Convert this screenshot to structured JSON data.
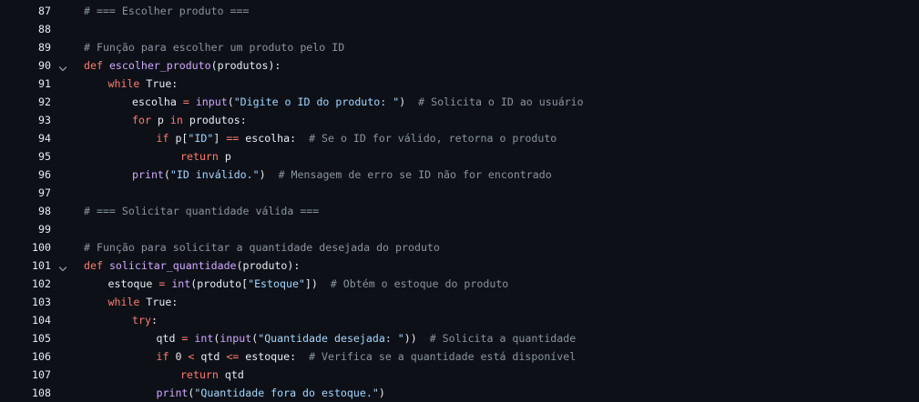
{
  "colors": {
    "background": "#0d1117",
    "text": "#e6edf3",
    "keyword": "#ff7b72",
    "function": "#d2a8ff",
    "string": "#a5d6ff",
    "comment": "#8b949e",
    "gutter": "#e6edf3"
  },
  "fold_icon": "chevron-down-icon",
  "lines": [
    {
      "n": "87",
      "indent": 0,
      "fold": false,
      "tokens": [
        {
          "t": "# === Escolher produto ===",
          "c": "cm"
        }
      ]
    },
    {
      "n": "88",
      "indent": 0,
      "fold": false,
      "tokens": []
    },
    {
      "n": "89",
      "indent": 0,
      "fold": false,
      "tokens": [
        {
          "t": "# Função para escolher um produto pelo ID",
          "c": "cm"
        }
      ]
    },
    {
      "n": "90",
      "indent": 0,
      "fold": true,
      "tokens": [
        {
          "t": "def",
          "c": "kw"
        },
        {
          "t": " ",
          "c": "tok"
        },
        {
          "t": "escolher_produto",
          "c": "fn"
        },
        {
          "t": "(produtos):",
          "c": "tok"
        }
      ]
    },
    {
      "n": "91",
      "indent": 1,
      "fold": false,
      "tokens": [
        {
          "t": "while",
          "c": "kw"
        },
        {
          "t": " True:",
          "c": "tok"
        }
      ]
    },
    {
      "n": "92",
      "indent": 2,
      "fold": false,
      "tokens": [
        {
          "t": "escolha ",
          "c": "tok"
        },
        {
          "t": "=",
          "c": "kw"
        },
        {
          "t": " ",
          "c": "tok"
        },
        {
          "t": "input",
          "c": "fn"
        },
        {
          "t": "(",
          "c": "tok"
        },
        {
          "t": "\"Digite o ID do produto: \"",
          "c": "str"
        },
        {
          "t": ")  ",
          "c": "tok"
        },
        {
          "t": "# Solicita o ID ao usuário",
          "c": "cm"
        }
      ]
    },
    {
      "n": "93",
      "indent": 2,
      "fold": false,
      "tokens": [
        {
          "t": "for",
          "c": "kw"
        },
        {
          "t": " p ",
          "c": "tok"
        },
        {
          "t": "in",
          "c": "kw"
        },
        {
          "t": " produtos:",
          "c": "tok"
        }
      ]
    },
    {
      "n": "94",
      "indent": 3,
      "fold": false,
      "tokens": [
        {
          "t": "if",
          "c": "kw"
        },
        {
          "t": " p[",
          "c": "tok"
        },
        {
          "t": "\"ID\"",
          "c": "str"
        },
        {
          "t": "] ",
          "c": "tok"
        },
        {
          "t": "==",
          "c": "kw"
        },
        {
          "t": " escolha:  ",
          "c": "tok"
        },
        {
          "t": "# Se o ID for válido, retorna o produto",
          "c": "cm"
        }
      ]
    },
    {
      "n": "95",
      "indent": 4,
      "fold": false,
      "tokens": [
        {
          "t": "return",
          "c": "kw"
        },
        {
          "t": " p",
          "c": "tok"
        }
      ]
    },
    {
      "n": "96",
      "indent": 2,
      "fold": false,
      "tokens": [
        {
          "t": "print",
          "c": "fn"
        },
        {
          "t": "(",
          "c": "tok"
        },
        {
          "t": "\"ID inválido.\"",
          "c": "str"
        },
        {
          "t": ")  ",
          "c": "tok"
        },
        {
          "t": "# Mensagem de erro se ID não for encontrado",
          "c": "cm"
        }
      ]
    },
    {
      "n": "97",
      "indent": 0,
      "fold": false,
      "tokens": []
    },
    {
      "n": "98",
      "indent": 0,
      "fold": false,
      "tokens": [
        {
          "t": "# === Solicitar quantidade válida ===",
          "c": "cm"
        }
      ]
    },
    {
      "n": "99",
      "indent": 0,
      "fold": false,
      "tokens": []
    },
    {
      "n": "100",
      "indent": 0,
      "fold": false,
      "tokens": [
        {
          "t": "# Função para solicitar a quantidade desejada do produto",
          "c": "cm"
        }
      ]
    },
    {
      "n": "101",
      "indent": 0,
      "fold": true,
      "tokens": [
        {
          "t": "def",
          "c": "kw"
        },
        {
          "t": " ",
          "c": "tok"
        },
        {
          "t": "solicitar_quantidade",
          "c": "fn"
        },
        {
          "t": "(produto):",
          "c": "tok"
        }
      ]
    },
    {
      "n": "102",
      "indent": 1,
      "fold": false,
      "tokens": [
        {
          "t": "estoque ",
          "c": "tok"
        },
        {
          "t": "=",
          "c": "kw"
        },
        {
          "t": " ",
          "c": "tok"
        },
        {
          "t": "int",
          "c": "fn"
        },
        {
          "t": "(produto[",
          "c": "tok"
        },
        {
          "t": "\"Estoque\"",
          "c": "str"
        },
        {
          "t": "])  ",
          "c": "tok"
        },
        {
          "t": "# Obtém o estoque do produto",
          "c": "cm"
        }
      ]
    },
    {
      "n": "103",
      "indent": 1,
      "fold": false,
      "tokens": [
        {
          "t": "while",
          "c": "kw"
        },
        {
          "t": " True:",
          "c": "tok"
        }
      ]
    },
    {
      "n": "104",
      "indent": 2,
      "fold": false,
      "tokens": [
        {
          "t": "try",
          "c": "kw"
        },
        {
          "t": ":",
          "c": "tok"
        }
      ]
    },
    {
      "n": "105",
      "indent": 3,
      "fold": false,
      "tokens": [
        {
          "t": "qtd ",
          "c": "tok"
        },
        {
          "t": "=",
          "c": "kw"
        },
        {
          "t": " ",
          "c": "tok"
        },
        {
          "t": "int",
          "c": "fn"
        },
        {
          "t": "(",
          "c": "tok"
        },
        {
          "t": "input",
          "c": "fn"
        },
        {
          "t": "(",
          "c": "tok"
        },
        {
          "t": "\"Quantidade desejada: \"",
          "c": "str"
        },
        {
          "t": "))  ",
          "c": "tok"
        },
        {
          "t": "# Solicita a quantidade",
          "c": "cm"
        }
      ]
    },
    {
      "n": "106",
      "indent": 3,
      "fold": false,
      "tokens": [
        {
          "t": "if",
          "c": "kw"
        },
        {
          "t": " 0 ",
          "c": "tok"
        },
        {
          "t": "<",
          "c": "kw"
        },
        {
          "t": " qtd ",
          "c": "tok"
        },
        {
          "t": "<=",
          "c": "kw"
        },
        {
          "t": " estoque:  ",
          "c": "tok"
        },
        {
          "t": "# Verifica se a quantidade está disponível",
          "c": "cm"
        }
      ]
    },
    {
      "n": "107",
      "indent": 4,
      "fold": false,
      "tokens": [
        {
          "t": "return",
          "c": "kw"
        },
        {
          "t": " qtd",
          "c": "tok"
        }
      ]
    },
    {
      "n": "108",
      "indent": 3,
      "fold": false,
      "tokens": [
        {
          "t": "print",
          "c": "fn"
        },
        {
          "t": "(",
          "c": "tok"
        },
        {
          "t": "\"Quantidade fora do estoque.\"",
          "c": "str"
        },
        {
          "t": ")",
          "c": "tok"
        }
      ]
    }
  ]
}
